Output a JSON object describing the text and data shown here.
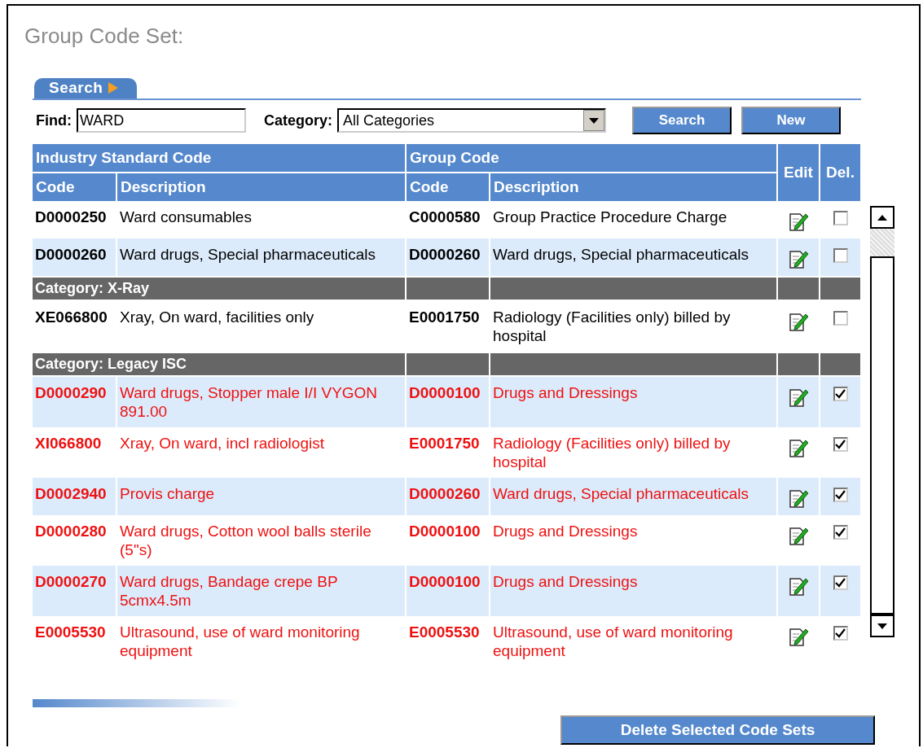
{
  "title": "Group Code Set:",
  "search_tab": {
    "label": "Search"
  },
  "find": {
    "label": "Find:",
    "value": "WARD"
  },
  "category": {
    "label": "Category:",
    "value": "All Categories"
  },
  "buttons": [
    "Search",
    "New"
  ],
  "table": {
    "group_headers": [
      "Industry Standard Code",
      "Group Code"
    ],
    "columns": [
      "Code",
      "Description",
      "Code",
      "Description",
      "Edit",
      "Del."
    ],
    "rows": [
      {
        "kind": "item",
        "code": "D0000250",
        "description": "Ward consumables",
        "group_code": "C0000580",
        "group_description": "Group Practice Procedure Charge",
        "highlighted": false,
        "checked": false
      },
      {
        "kind": "item",
        "code": "D0000260",
        "description": "Ward drugs, Special pharmaceuticals",
        "group_code": "D0000260",
        "group_description": "Ward drugs, Special pharmaceuticals",
        "highlighted": false,
        "checked": false
      },
      {
        "kind": "category",
        "label": "Category: X-Ray"
      },
      {
        "kind": "item",
        "code": "XE066800",
        "description": "Xray, On ward, facilities only",
        "group_code": "E0001750",
        "group_description": "Radiology (Facilities only) billed by hospital",
        "highlighted": false,
        "checked": false
      },
      {
        "kind": "category",
        "label": "Category: Legacy ISC"
      },
      {
        "kind": "item",
        "code": "D0000290",
        "description": "Ward drugs, Stopper male I/I VYGON 891.00",
        "group_code": "D0000100",
        "group_description": "Drugs and Dressings",
        "highlighted": true,
        "checked": true
      },
      {
        "kind": "item",
        "code": "XI066800",
        "description": "Xray, On ward, incl radiologist",
        "group_code": "E0001750",
        "group_description": "Radiology (Facilities only) billed by hospital",
        "highlighted": true,
        "checked": true
      },
      {
        "kind": "item",
        "code": "D0002940",
        "description": "Provis charge",
        "group_code": "D0000260",
        "group_description": "Ward drugs, Special pharmaceuticals",
        "highlighted": true,
        "checked": true
      },
      {
        "kind": "item",
        "code": "D0000280",
        "description": "Ward drugs, Cotton wool balls sterile (5\"s)",
        "group_code": "D0000100",
        "group_description": "Drugs and Dressings",
        "highlighted": true,
        "checked": true
      },
      {
        "kind": "item",
        "code": "D0000270",
        "description": "Ward drugs, Bandage crepe BP 5cmx4.5m",
        "group_code": "D0000100",
        "group_description": "Drugs and Dressings",
        "highlighted": true,
        "checked": true
      },
      {
        "kind": "item",
        "code": "E0005530",
        "description": "Ultrasound, use of ward monitoring equipment",
        "group_code": "E0005530",
        "group_description": "Ultrasound, use of ward monitoring equipment",
        "highlighted": true,
        "checked": true
      }
    ]
  },
  "delete_button": "Delete Selected Code Sets"
}
